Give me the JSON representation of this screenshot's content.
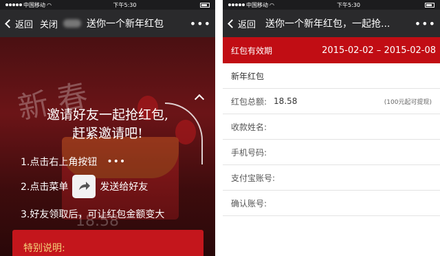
{
  "left": {
    "status": {
      "carrier": "中国移动",
      "time": "下午5:30"
    },
    "nav": {
      "back": "返回",
      "close": "关闭",
      "title": "送你一个新年红包",
      "more": "•••"
    },
    "hero_line1": "邀请好友一起抢红包,",
    "hero_line2": "赶紧邀请吧!",
    "steps": [
      {
        "text": "1.点击右上角按钮",
        "icon": "•••"
      },
      {
        "text_before": "2.点击菜单",
        "icon": "share-icon",
        "text_after": "发送给好友"
      },
      {
        "text": "3.好友领取后，可让红包金额变大"
      }
    ],
    "amount_bg": "18.58",
    "special_label": "特别说明:"
  },
  "right": {
    "status": {
      "carrier": "中国移动",
      "time": "下午5:30"
    },
    "nav": {
      "back": "返回",
      "title": "送你一个新年红包，一起抢...",
      "more": "•••"
    },
    "validity_label": "红包有效期",
    "validity_dates": "2015-02-02 – 2015-02-08",
    "packet_name": "新年红包",
    "total_label": "红包总额:",
    "total_value": "18.58",
    "total_note": "(100元起可提现)",
    "fields": [
      {
        "label": "收款姓名:",
        "placeholder": ""
      },
      {
        "label": "手机号码:",
        "placeholder": ""
      },
      {
        "label": "支付宝账号:",
        "placeholder": ""
      },
      {
        "label": "确认账号:",
        "placeholder": ""
      }
    ]
  },
  "colors": {
    "accent_red": "#c10d14",
    "nav_bg": "#2a2a2c",
    "special_text": "#f4d27a"
  }
}
